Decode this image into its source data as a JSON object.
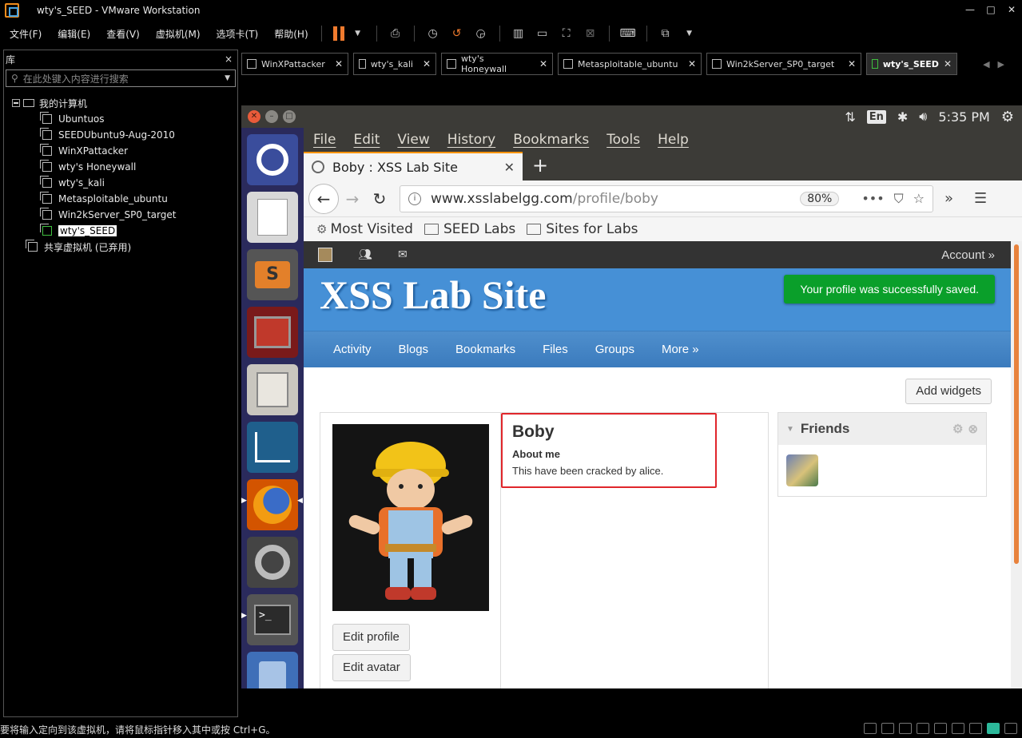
{
  "window": {
    "title": "wty's_SEED - VMware Workstation",
    "controls": [
      "—",
      "□",
      "✕"
    ]
  },
  "menubar": {
    "items": [
      "文件(F)",
      "编辑(E)",
      "查看(V)",
      "虚拟机(M)",
      "选项卡(T)",
      "帮助(H)"
    ]
  },
  "library": {
    "title": "库",
    "close": "×",
    "search_placeholder": "在此处键入内容进行搜索",
    "root": "我的计算机",
    "vms": [
      "Ubuntuos",
      "SEEDUbuntu9-Aug-2010",
      "WinXPattacker",
      "wty's Honeywall",
      "wty's_kali",
      "Metasploitable_ubuntu",
      "Win2kServer_SP0_target",
      "wty's_SEED"
    ],
    "shared": "共享虚拟机 (已弃用)"
  },
  "vm_tabs": [
    {
      "label": "WinXPattacker"
    },
    {
      "label": "wty's_kali"
    },
    {
      "label": "wty's Honeywall"
    },
    {
      "label": "Metasploitable_ubuntu"
    },
    {
      "label": "Win2kServer_SP0_target"
    },
    {
      "label": "wty's_SEED"
    }
  ],
  "guest": {
    "tray": {
      "lang": "En",
      "time": "5:35 PM"
    },
    "firefox": {
      "menu": [
        "File",
        "Edit",
        "View",
        "History",
        "Bookmarks",
        "Tools",
        "Help"
      ],
      "tab_title": "Boby : XSS Lab Site",
      "url_host": "www.xsslabelgg.com",
      "url_path": "/profile/boby",
      "zoom": "80%",
      "bookmarks": [
        "Most Visited",
        "SEED Labs",
        "Sites for Labs"
      ]
    },
    "page": {
      "account": "Account »",
      "site_name": "XSS Lab Site",
      "notice": "Your profile was successfully saved.",
      "nav": [
        "Activity",
        "Blogs",
        "Bookmarks",
        "Files",
        "Groups",
        "More »"
      ],
      "add_widgets": "Add widgets",
      "profile_name": "Boby",
      "about_label": "About me",
      "about_text": "This have been cracked by alice.",
      "edit_profile": "Edit profile",
      "edit_avatar": "Edit avatar",
      "friends_title": "Friends"
    }
  },
  "status": {
    "message": "要将输入定向到该虚拟机，请将鼠标指针移入其中或按 Ctrl+G。"
  },
  "colors": {
    "accent_orange": "#f07b2e",
    "elgg_blue": "#4690d6",
    "notice_green": "#0a9f2a",
    "highlight_red": "#e0262b"
  }
}
